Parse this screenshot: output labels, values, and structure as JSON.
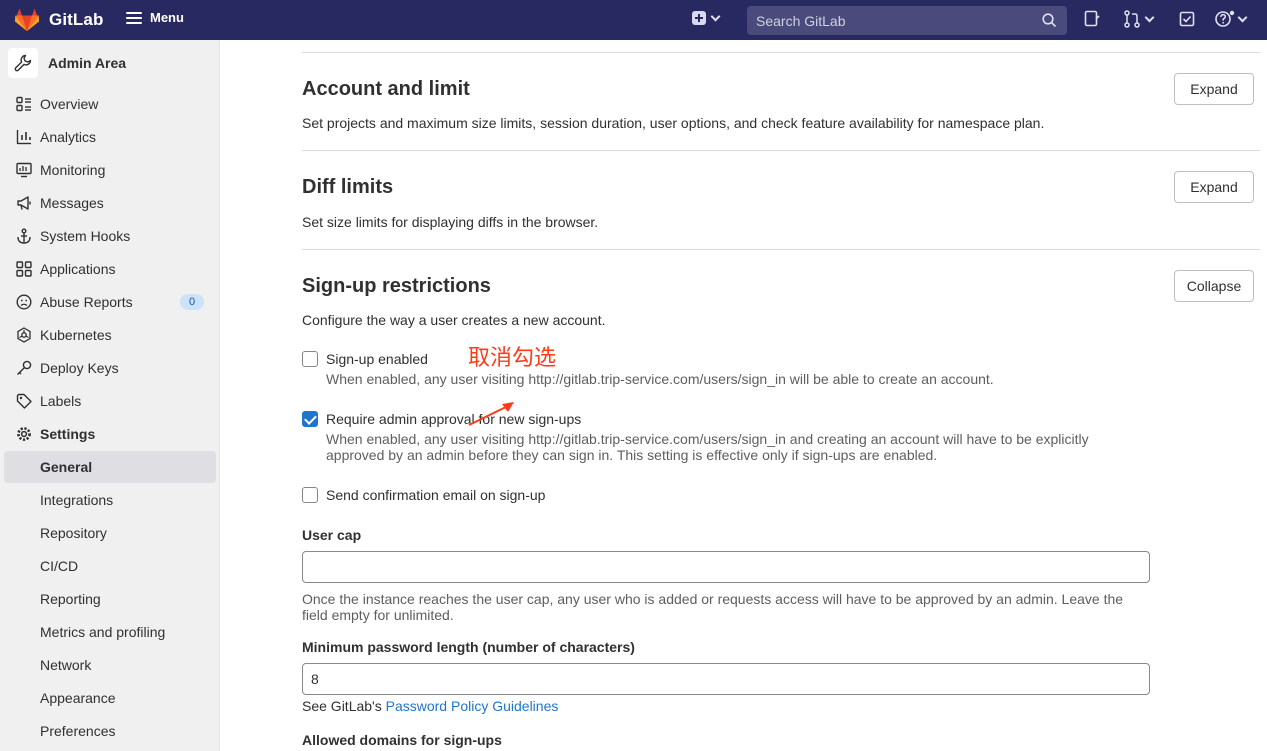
{
  "app": {
    "name": "GitLab"
  },
  "topbar": {
    "menu_label": "Menu",
    "search_placeholder": "Search GitLab"
  },
  "sidebar": {
    "header": "Admin Area",
    "items": [
      {
        "label": "Overview",
        "icon": "overview-icon"
      },
      {
        "label": "Analytics",
        "icon": "analytics-icon"
      },
      {
        "label": "Monitoring",
        "icon": "monitoring-icon"
      },
      {
        "label": "Messages",
        "icon": "megaphone-icon"
      },
      {
        "label": "System Hooks",
        "icon": "anchor-icon"
      },
      {
        "label": "Applications",
        "icon": "applications-icon"
      },
      {
        "label": "Abuse Reports",
        "icon": "abuse-icon",
        "badge": "0"
      },
      {
        "label": "Kubernetes",
        "icon": "kubernetes-icon"
      },
      {
        "label": "Deploy Keys",
        "icon": "key-icon"
      },
      {
        "label": "Labels",
        "icon": "label-icon"
      },
      {
        "label": "Settings",
        "icon": "gear-icon"
      }
    ],
    "settings_sub": [
      "General",
      "Integrations",
      "Repository",
      "CI/CD",
      "Reporting",
      "Metrics and profiling",
      "Network",
      "Appearance",
      "Preferences"
    ]
  },
  "sections": {
    "account": {
      "title": "Account and limit",
      "desc": "Set projects and maximum size limits, session duration, user options, and check feature availability for namespace plan.",
      "button": "Expand"
    },
    "diff": {
      "title": "Diff limits",
      "desc": "Set size limits for displaying diffs in the browser.",
      "button": "Expand"
    },
    "signup": {
      "title": "Sign-up restrictions",
      "desc": "Configure the way a user creates a new account.",
      "button": "Collapse",
      "signup_enabled": {
        "label": "Sign-up enabled",
        "checked": false,
        "help": "When enabled, any user visiting http://gitlab.trip-service.com/users/sign_in will be able to create an account."
      },
      "require_approval": {
        "label": "Require admin approval for new sign-ups",
        "checked": true,
        "help": "When enabled, any user visiting http://gitlab.trip-service.com/users/sign_in and creating an account will have to be explicitly approved by an admin before they can sign in. This setting is effective only if sign-ups are enabled."
      },
      "confirmation_email": {
        "label": "Send confirmation email on sign-up",
        "checked": false
      },
      "user_cap": {
        "label": "User cap",
        "value": "",
        "help": "Once the instance reaches the user cap, any user who is added or requests access will have to be approved by an admin. Leave the field empty for unlimited."
      },
      "min_password": {
        "label": "Minimum password length (number of characters)",
        "value": "8",
        "help_prefix": "See GitLab's ",
        "help_link": "Password Policy Guidelines"
      },
      "allowed_domains": {
        "label": "Allowed domains for sign-ups"
      }
    }
  },
  "annotation": {
    "text": "取消勾选",
    "color": "#ff3b1a"
  },
  "colors": {
    "topbar": "#292961",
    "accent": "#1f75cb",
    "gitlab_orange": "#fc6d26"
  }
}
